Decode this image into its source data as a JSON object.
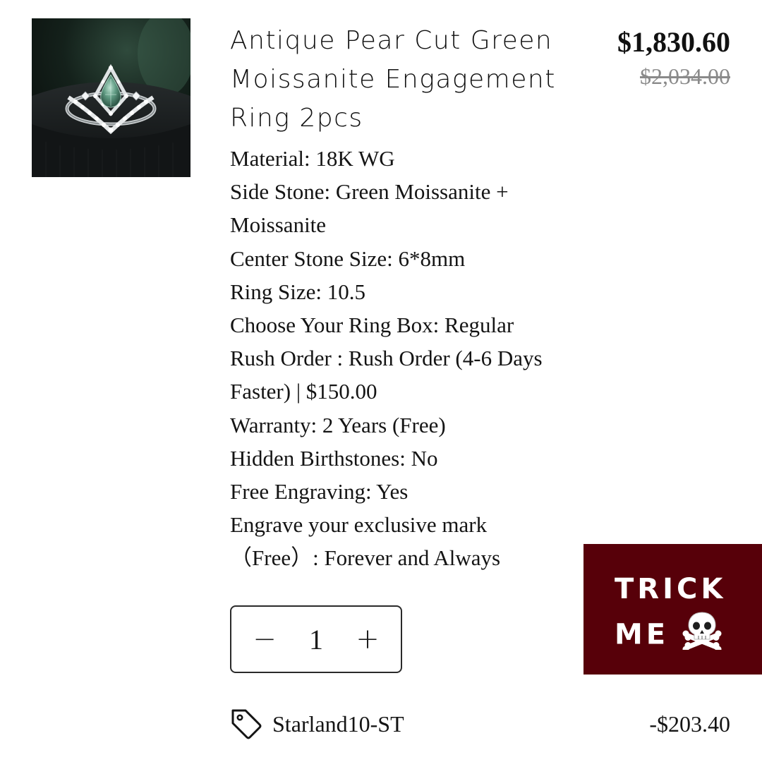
{
  "product": {
    "image_name": "ring-product-image",
    "title": "Antique Pear Cut Green Moissanite Engagement Ring 2pcs",
    "price_current": "$1,830.60",
    "price_original": "$2,034.00"
  },
  "options": [
    "Material: 18K WG",
    "Side Stone: Green Moissanite + Moissanite",
    "Center Stone Size: 6*8mm",
    "Ring Size: 10.5",
    "Choose Your Ring Box: Regular",
    "Rush Order : Rush Order (4-6 Days Faster) | $150.00",
    "Warranty: 2 Years (Free)",
    "Hidden Birthstones: No",
    "Free Engraving: Yes",
    "Engrave your exclusive mark （Free）: Forever and Always"
  ],
  "quantity": {
    "decrement_label": "−",
    "value": "1",
    "increment_label": "+"
  },
  "promo": {
    "line1": "TRICK",
    "line2": "ME",
    "icon": "skull-crossbones-icon",
    "background": "#570009"
  },
  "discount": {
    "icon": "tag-icon",
    "code": "Starland10-ST",
    "amount": "-$203.40"
  }
}
